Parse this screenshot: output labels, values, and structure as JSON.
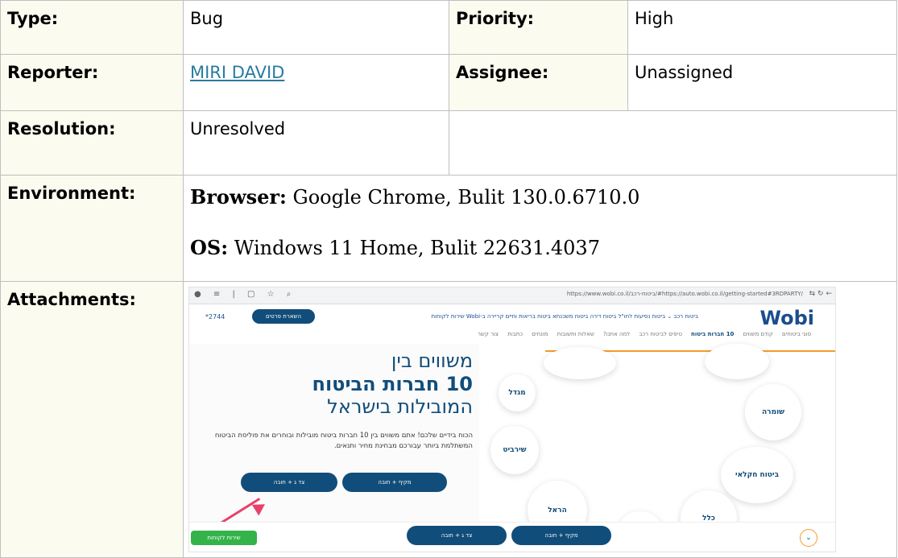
{
  "issue": {
    "type_label": "Type:",
    "type_value": "Bug",
    "priority_label": "Priority:",
    "priority_value": "High",
    "reporter_label": "Reporter:",
    "reporter_value": "MIRI DAVID",
    "assignee_label": "Assignee:",
    "assignee_value": "Unassigned",
    "resolution_label": "Resolution:",
    "resolution_value": "Unresolved",
    "environment_label": "Environment:",
    "env_browser_key": "Browser:",
    "env_browser_value": " Google Chrome, Bulit 130.0.6710.0",
    "env_os_key": "OS:",
    "env_os_value": " Windows 11 Home, Bulit 22631.4037",
    "attachments_label": "Attachments:"
  },
  "screenshot": {
    "url": "https://www.wobi.co.il/ביטוח-רכב/#https://auto.wobi.co.il/getting-started#3RDPARTY/",
    "logo": "Wobi",
    "menu": "ביטוח רכב ⌄    ביטוח נסיעות לחו\"ל    ביטוח דירה    ביטוח משכנתא    ביטוח בריאות וחיים    קריירה ב-Wobi    שירות לקוחות",
    "cta": "השארת פרטים",
    "phone": "*2744",
    "subnav_items": [
      "סוגי ביטוחים",
      "קודם משווים",
      "10 חברות ביטוח",
      "טיפים לביטוח רכב",
      "למה אתנו?",
      "שאלות ותשובות",
      "מונחים",
      "כתבות",
      "צור קשר"
    ],
    "hero_line1": "משווים בין",
    "hero_line2": "10 חברות הביטוח",
    "hero_line3": "המובילות בישראל",
    "hero_para": "הכוח בידיים שלכם! אתם משווים בין 10 חברות ביטוח מובילות ובוחרים את פוליסת הביטוח המשתלמת ביותר עבורכם מבחינת מחיר ותנאים.",
    "btn_comprehensive": "מקיף + חובה",
    "btn_third_party": "צד ג + חובה",
    "insurers": [
      "הראל",
      "כלל",
      "שירביט",
      "שומרה",
      "ביטוח חקלאי",
      "מגדל"
    ],
    "whatsapp": "שירות לקוחות",
    "scroll_label": "לפסגה"
  }
}
